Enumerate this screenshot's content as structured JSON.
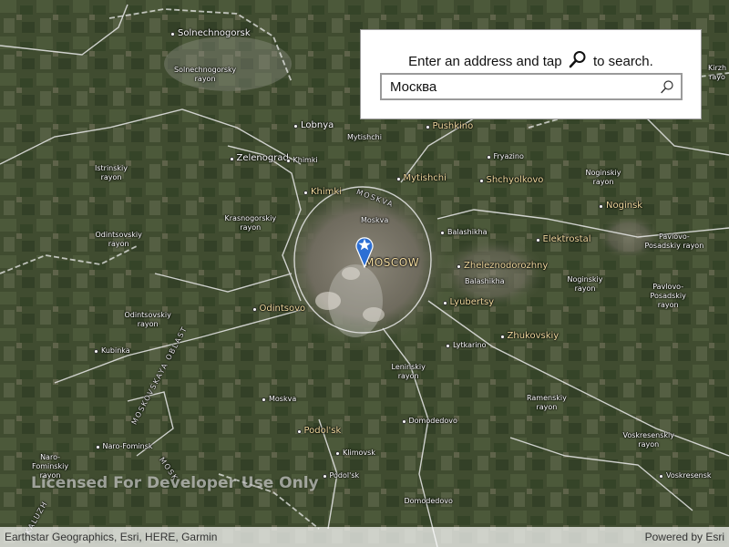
{
  "search": {
    "prompt_before": "Enter an address and tap",
    "prompt_after": "to search.",
    "value": "Москва",
    "search_icon": "magnifier-icon"
  },
  "map": {
    "basemap": "imagery with labels",
    "watermark": "Licensed For Developer Use Only",
    "attribution": "Earthstar Geographics, Esri, HERE, Garmin",
    "powered_by": "Powered by Esri",
    "pin_icon": "map-pin-star-icon",
    "pin_color": "#2d6fd4",
    "labels": [
      {
        "id": "solnechnogorsk",
        "text": "Solnechnogorsk"
      },
      {
        "id": "solnechnogorsky-rayon",
        "text": "Solnechnogorsky\nrayon"
      },
      {
        "id": "lobnya",
        "text": "Lobnya"
      },
      {
        "id": "mytishchi-small",
        "text": "Mytishchi"
      },
      {
        "id": "pushkino",
        "text": "Pushkino"
      },
      {
        "id": "fryazino",
        "text": "Fryazino"
      },
      {
        "id": "shchyolkovo",
        "text": "Shchyolkovo"
      },
      {
        "id": "zelenograd",
        "text": "Zelenograd"
      },
      {
        "id": "khimki-small",
        "text": "Khimki"
      },
      {
        "id": "mytishchi",
        "text": "Mytishchi"
      },
      {
        "id": "noginsky-rayon",
        "text": "Noginskiy\nrayon"
      },
      {
        "id": "noginsk",
        "text": "Noginsk"
      },
      {
        "id": "istrinsky-rayon",
        "text": "Istrinskiy\nrayon"
      },
      {
        "id": "khimki",
        "text": "Khimki"
      },
      {
        "id": "moskva-road",
        "text": "MOSKVA"
      },
      {
        "id": "moskva-small",
        "text": "Moskva"
      },
      {
        "id": "balashikha",
        "text": "Balashikha"
      },
      {
        "id": "krasnogorsky",
        "text": "Krasnogorskiy\nrayon"
      },
      {
        "id": "elektrostal",
        "text": "Elektrostal"
      },
      {
        "id": "pavlovo-1",
        "text": "Pavlovo-\nPosadskiy rayon"
      },
      {
        "id": "odintsovsky-rayon",
        "text": "Odintsovskiy\nrayon"
      },
      {
        "id": "moscow",
        "text": "MOSCOW"
      },
      {
        "id": "zheleznodorozhny",
        "text": "Zheleznodorozhny"
      },
      {
        "id": "balashikha-2",
        "text": "Balashikha"
      },
      {
        "id": "noginsky-rayon-2",
        "text": "Noginskiy\nrayon"
      },
      {
        "id": "lyubertsy",
        "text": "Lyubertsy"
      },
      {
        "id": "pavlovo-2",
        "text": "Pavlovo-\nPosadskiy\nrayon"
      },
      {
        "id": "odintsovo",
        "text": "Odintsovo"
      },
      {
        "id": "odintsovsky-2",
        "text": "Odintsovskiy\nrayon"
      },
      {
        "id": "zhukovsky",
        "text": "Zhukovskiy"
      },
      {
        "id": "lytkarino",
        "text": "Lytkarino"
      },
      {
        "id": "kubinka",
        "text": "Kubinka"
      },
      {
        "id": "moskovskaya-oblast",
        "text": "MOSKOVSKAYA OBLAST"
      },
      {
        "id": "leninsky",
        "text": "Leninskiy\nrayon"
      },
      {
        "id": "moskva-sw",
        "text": "Moskva"
      },
      {
        "id": "ramensky",
        "text": "Ramenskiy\nrayon"
      },
      {
        "id": "podolsk",
        "text": "Podol'sk"
      },
      {
        "id": "domodedovo-1",
        "text": "Domodedovo"
      },
      {
        "id": "voskresensky",
        "text": "Voskresenskiy\nrayon"
      },
      {
        "id": "naro-fominsk",
        "text": "Naro-Fominsk"
      },
      {
        "id": "naro-fominsky",
        "text": "Naro-\nFominskiy\nrayon"
      },
      {
        "id": "klimovsk",
        "text": "Klimovsk"
      },
      {
        "id": "podolsk-2",
        "text": "Podol'sk"
      },
      {
        "id": "voskresensk",
        "text": "Voskresensk"
      },
      {
        "id": "domodedovo-2",
        "text": "Domodedovo"
      },
      {
        "id": "kirzha",
        "text": "Kirzh\nrayo"
      },
      {
        "id": "kaluzh",
        "text": "KALUZH"
      },
      {
        "id": "mosk-diag",
        "text": "MOSK"
      }
    ]
  }
}
